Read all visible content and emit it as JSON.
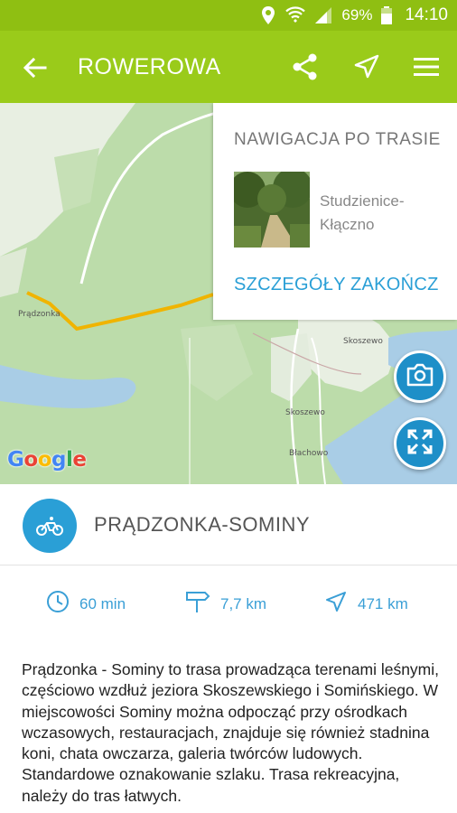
{
  "status_bar": {
    "battery_percent": "69%",
    "time": "14:10",
    "icons": [
      "location-icon",
      "wifi-icon",
      "signal-icon",
      "battery-icon"
    ]
  },
  "app_bar": {
    "title": "ROWEROWA",
    "icons": [
      "back-arrow-icon",
      "share-icon",
      "navigate-icon",
      "menu-icon"
    ]
  },
  "map": {
    "labels": {
      "pradzonka": "Prądzonka",
      "skoszewo_north": "Skoszewo",
      "skoszewo_south": "Skoszewo",
      "blachowo": "Błachowo"
    },
    "attribution": "Google",
    "buttons": [
      "camera-icon",
      "expand-icon"
    ]
  },
  "navigation_card": {
    "title": "NAWIGACJA PO TRASIE",
    "destination": "Studzienice-Kłączno",
    "details_label": "SZCZEGÓŁY",
    "end_label": "ZAKOŃCZ"
  },
  "route": {
    "title": "PRĄDZONKA-SOMINY",
    "icon": "bicycle-icon"
  },
  "stats": {
    "time": "60 min",
    "distance": "7,7 km",
    "elevation": "471 km"
  },
  "description": "Prądzonka - Sominy   to trasa prowadząca terenami leśnymi, częściowo wzdłuż jeziora Skoszewskiego i Somińskiego. W miejscowości Sominy można odpocząć przy ośrodkach wczasowych, restauracjach, znajduje się również stadnina koni, chata owczarza, galeria twórców ludowych. Standardowe oznakowanie szlaku. Trasa rekreacyjna, należy do tras łatwych.",
  "colors": {
    "status_bar": "#8fbf12",
    "app_bar": "#9acb1a",
    "accent_blue": "#2a9fd6",
    "route_line": "#f0b400",
    "forest": "#b9d9a8",
    "water": "#a9cde6"
  }
}
